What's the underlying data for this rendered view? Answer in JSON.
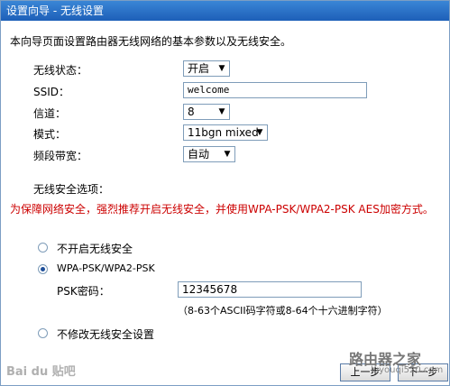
{
  "window": {
    "title": "设置向导 - 无线设置"
  },
  "intro": "本向导页面设置路由器无线网络的基本参数以及无线安全。",
  "fields": {
    "wireless_status": {
      "label": "无线状态：",
      "value": "开启"
    },
    "ssid": {
      "label": "SSID：",
      "value": "welcome"
    },
    "channel": {
      "label": "信道：",
      "value": "8"
    },
    "mode": {
      "label": "模式：",
      "value": "11bgn mixed"
    },
    "bandwidth": {
      "label": "频段带宽：",
      "value": "自动"
    }
  },
  "security": {
    "title": "无线安全选项：",
    "warning": "为保障网络安全，强烈推荐开启无线安全，并使用WPA-PSK/WPA2-PSK AES加密方式。",
    "options": {
      "disable": "不开启无线安全",
      "wpa": "WPA-PSK/WPA2-PSK",
      "nochange": "不修改无线安全设置"
    },
    "psk_label": "PSK密码：",
    "psk_value": "12345678",
    "psk_hint": "（8-63个ASCII码字符或8-64个十六进制字符）"
  },
  "buttons": {
    "prev": "上一步",
    "next": "下一步"
  },
  "watermark": {
    "logo": "Bai du 贴吧",
    "site": "路由器之家",
    "site_url": "luyouqi520.com"
  }
}
